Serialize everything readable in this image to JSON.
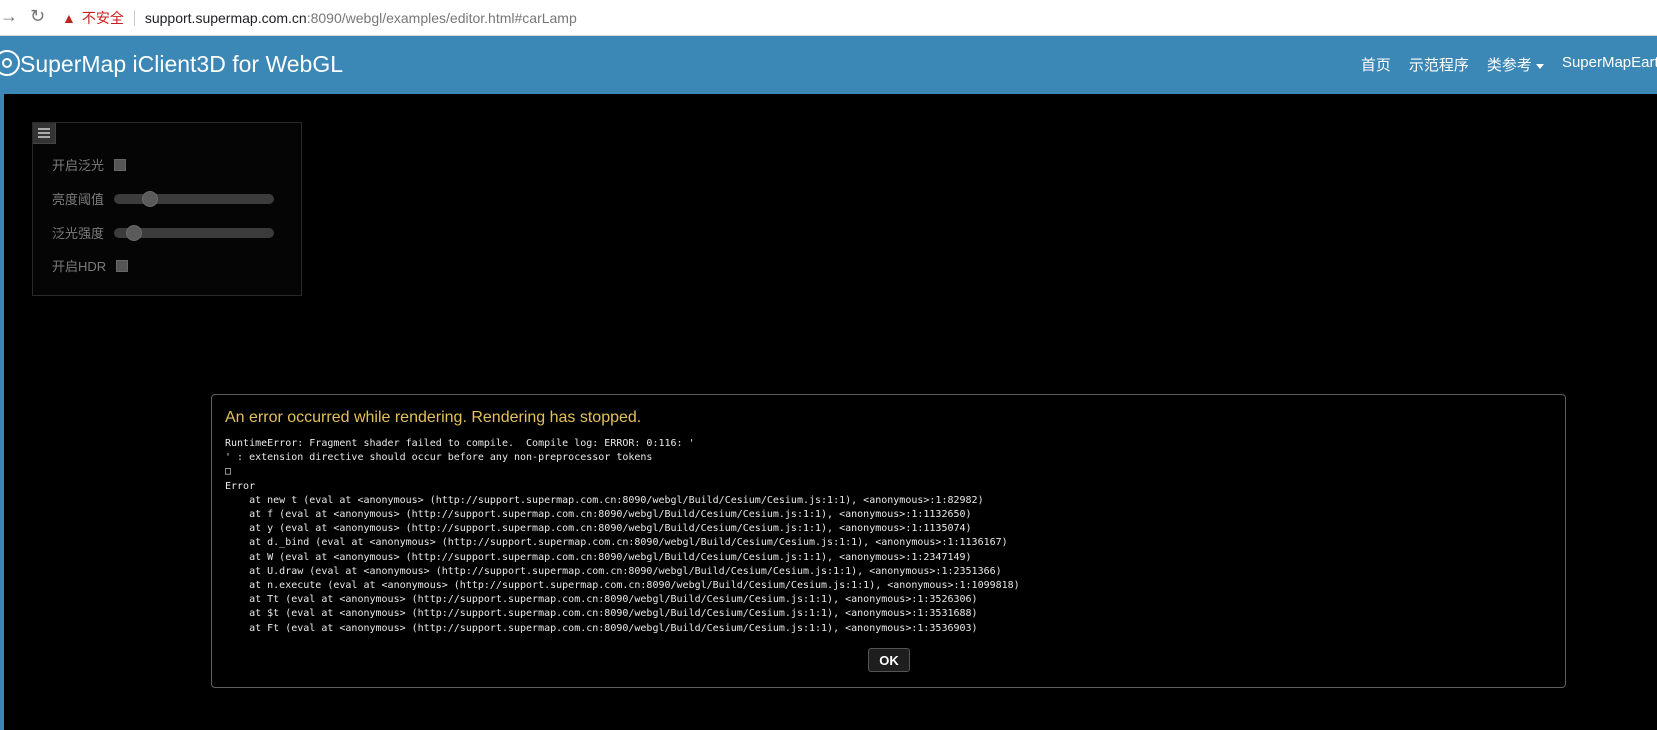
{
  "browser": {
    "insecure_label": "不安全",
    "url_host": "support.supermap.com.cn",
    "url_rest": ":8090/webgl/examples/editor.html#carLamp"
  },
  "header": {
    "title": "SuperMap iClient3D for WebGL",
    "nav": [
      {
        "label": "首页"
      },
      {
        "label": "示范程序"
      },
      {
        "label": "类参考"
      },
      {
        "label": "SuperMapEarth"
      }
    ]
  },
  "panel": {
    "bloom_label": "开启泛光",
    "bloom_checked": false,
    "brightness_label": "亮度阈值",
    "brightness_value": 0.22,
    "intensity_label": "泛光强度",
    "intensity_value": 0.12,
    "hdr_label": "开启HDR",
    "hdr_checked": false
  },
  "dialog": {
    "title": "An error occurred while rendering. Rendering has stopped.",
    "log": "RuntimeError: Fragment shader failed to compile.  Compile log: ERROR: 0:116: '\n' : extension directive should occur before any non-preprocessor tokens\n□\nError\n    at new t (eval at <anonymous> (http://support.supermap.com.cn:8090/webgl/Build/Cesium/Cesium.js:1:1), <anonymous>:1:82982)\n    at f (eval at <anonymous> (http://support.supermap.com.cn:8090/webgl/Build/Cesium/Cesium.js:1:1), <anonymous>:1:1132650)\n    at y (eval at <anonymous> (http://support.supermap.com.cn:8090/webgl/Build/Cesium/Cesium.js:1:1), <anonymous>:1:1135074)\n    at d._bind (eval at <anonymous> (http://support.supermap.com.cn:8090/webgl/Build/Cesium/Cesium.js:1:1), <anonymous>:1:1136167)\n    at W (eval at <anonymous> (http://support.supermap.com.cn:8090/webgl/Build/Cesium/Cesium.js:1:1), <anonymous>:1:2347149)\n    at U.draw (eval at <anonymous> (http://support.supermap.com.cn:8090/webgl/Build/Cesium/Cesium.js:1:1), <anonymous>:1:2351366)\n    at n.execute (eval at <anonymous> (http://support.supermap.com.cn:8090/webgl/Build/Cesium/Cesium.js:1:1), <anonymous>:1:1099818)\n    at Tt (eval at <anonymous> (http://support.supermap.com.cn:8090/webgl/Build/Cesium/Cesium.js:1:1), <anonymous>:1:3526306)\n    at $t (eval at <anonymous> (http://support.supermap.com.cn:8090/webgl/Build/Cesium/Cesium.js:1:1), <anonymous>:1:3531688)\n    at Ft (eval at <anonymous> (http://support.supermap.com.cn:8090/webgl/Build/Cesium/Cesium.js:1:1), <anonymous>:1:3536903)",
    "ok_label": "OK"
  }
}
